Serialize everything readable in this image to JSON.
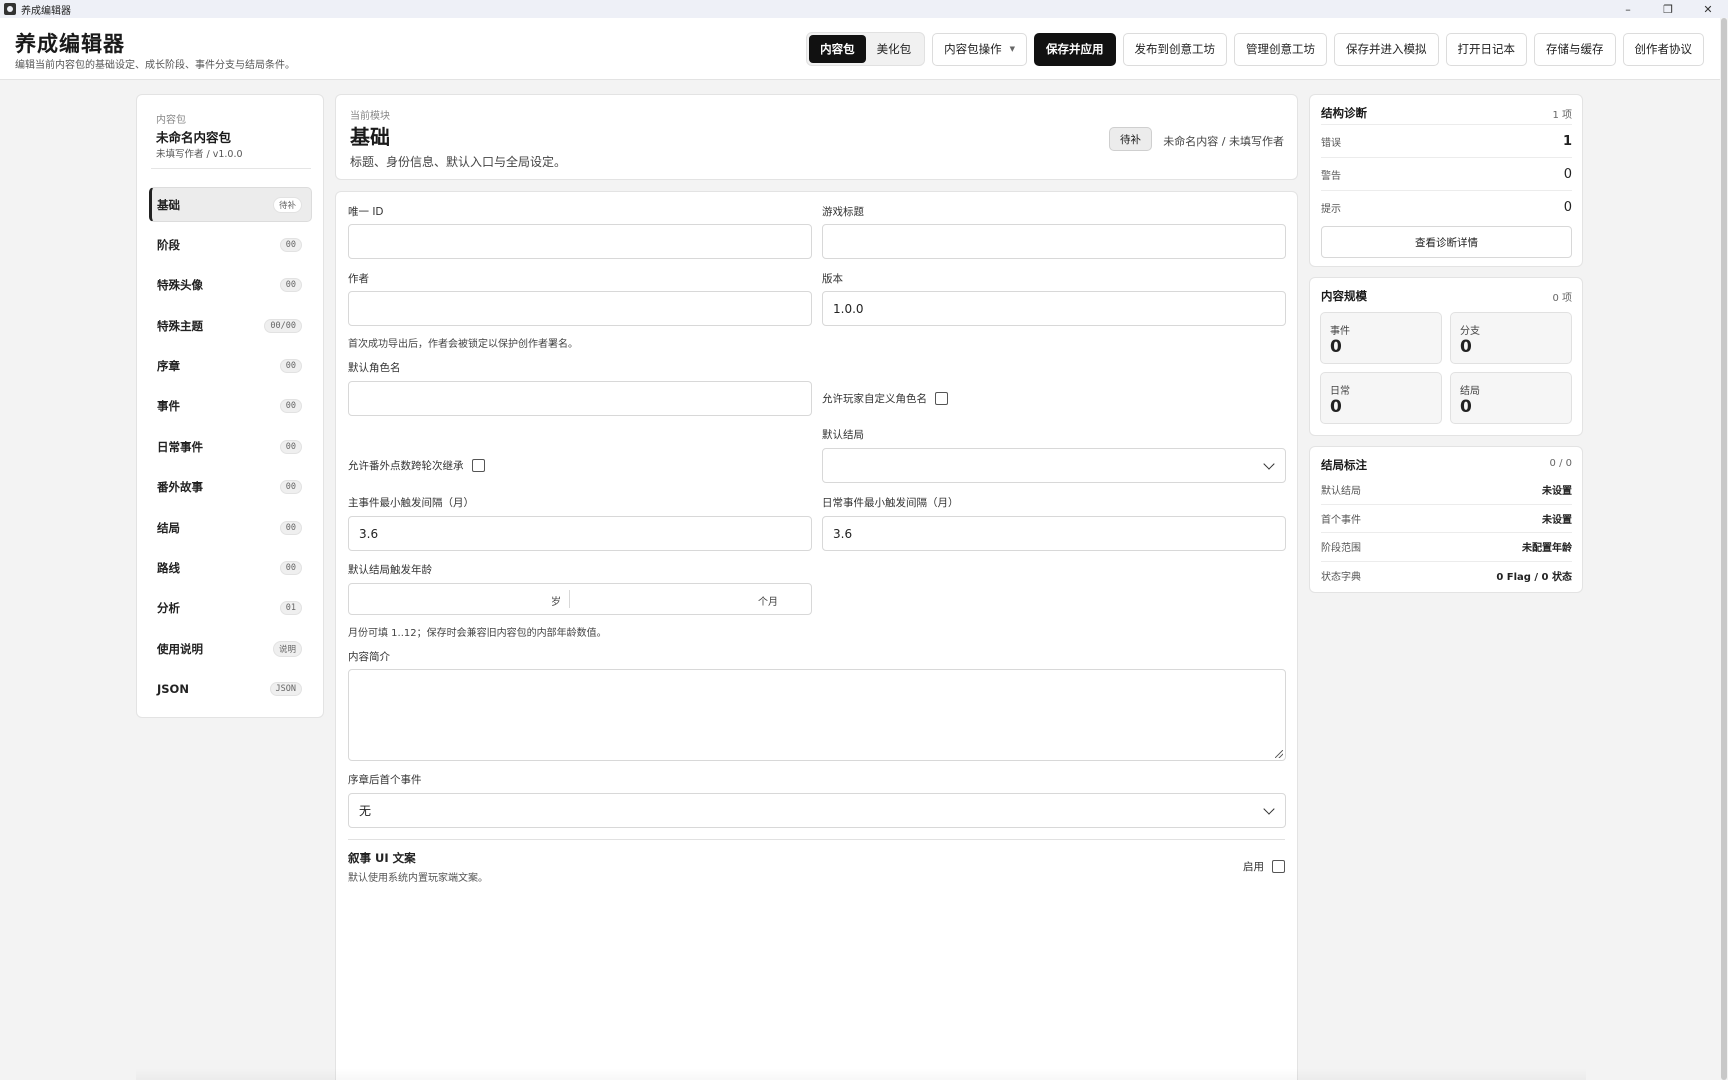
{
  "window": {
    "title": "养成编辑器",
    "minimize": "–",
    "maximize": "❐",
    "close": "✕"
  },
  "header": {
    "app_name": "养成编辑器",
    "subtitle": "编辑当前内容包的基础设定、成长阶段、事件分支与结局条件。",
    "mode_tabs": [
      {
        "label": "内容包",
        "active": true
      },
      {
        "label": "美化包",
        "active": false
      }
    ],
    "buttons": {
      "pack_ops": "内容包操作",
      "save_apply": "保存并应用",
      "publish": "发布到创意工坊",
      "manage": "管理创意工坊",
      "save_sim": "保存并进入模拟",
      "open_log": "打开日记本",
      "storage": "存储与缓存",
      "agreement": "创作者协议"
    }
  },
  "sidebar": {
    "pack_label": "内容包",
    "pack_name": "未命名内容包",
    "pack_meta": "未填写作者 / v1.0.0",
    "items": [
      {
        "label": "基础",
        "badge": "待补",
        "active": true
      },
      {
        "label": "阶段",
        "badge": "00"
      },
      {
        "label": "特殊头像",
        "badge": "00"
      },
      {
        "label": "特殊主题",
        "badge": "00/00"
      },
      {
        "label": "序章",
        "badge": "00"
      },
      {
        "label": "事件",
        "badge": "00"
      },
      {
        "label": "日常事件",
        "badge": "00"
      },
      {
        "label": "番外故事",
        "badge": "00"
      },
      {
        "label": "结局",
        "badge": "00"
      },
      {
        "label": "路线",
        "badge": "00"
      },
      {
        "label": "分析",
        "badge": "01"
      },
      {
        "label": "使用说明",
        "badge": "说明"
      },
      {
        "label": "JSON",
        "badge": "JSON"
      }
    ]
  },
  "module": {
    "kicker": "当前模块",
    "title": "基础",
    "desc": "标题、身份信息、默认入口与全局设定。",
    "status": "待补",
    "meta": "未命名内容 / 未填写作者"
  },
  "form": {
    "unique_id": {
      "label": "唯一 ID",
      "value": ""
    },
    "game_title": {
      "label": "游戏标题",
      "value": ""
    },
    "author": {
      "label": "作者",
      "value": ""
    },
    "version": {
      "label": "版本",
      "value": "1.0.0"
    },
    "author_hint": "首次成功导出后，作者会被锁定以保护创作者署名。",
    "default_role": {
      "label": "默认角色名",
      "value": ""
    },
    "allow_custom_name": "允许玩家自定义角色名",
    "allow_extra_points": "允许番外点数跨轮次继承",
    "default_ending": {
      "label": "默认结局",
      "value": ""
    },
    "main_interval": {
      "label": "主事件最小触发间隔（月）",
      "value": "3.6"
    },
    "daily_interval": {
      "label": "日常事件最小触发间隔（月）",
      "value": "3.6"
    },
    "ending_age": {
      "label": "默认结局触发年龄",
      "unit_year": "岁",
      "unit_month": "个月"
    },
    "age_hint": "月份可填 1..12；保存时会兼容旧内容包的内部年龄数值。",
    "intro": {
      "label": "内容简介",
      "value": ""
    },
    "first_event": {
      "label": "序章后首个事件",
      "value": "无"
    },
    "narrative": {
      "title": "叙事 UI 文案",
      "sub": "默认使用系统内置玩家端文案。",
      "enable_label": "启用"
    }
  },
  "diagnostics": {
    "title": "结构诊断",
    "count": "1 项",
    "rows": [
      {
        "label": "错误",
        "value": "1"
      },
      {
        "label": "警告",
        "value": "0"
      },
      {
        "label": "提示",
        "value": "0"
      }
    ],
    "button": "查看诊断详情"
  },
  "scale": {
    "title": "内容规模",
    "count": "0 项",
    "boxes": [
      {
        "label": "事件",
        "value": "0"
      },
      {
        "label": "分支",
        "value": "0"
      },
      {
        "label": "日常",
        "value": "0"
      },
      {
        "label": "结局",
        "value": "0"
      }
    ]
  },
  "endings": {
    "title": "结局标注",
    "count": "0 / 0",
    "rows": [
      {
        "label": "默认结局",
        "value": "未设置"
      },
      {
        "label": "首个事件",
        "value": "未设置"
      },
      {
        "label": "阶段范围",
        "value": "未配置年龄"
      },
      {
        "label": "状态字典",
        "value": "0 Flag / 0 状态"
      }
    ]
  }
}
